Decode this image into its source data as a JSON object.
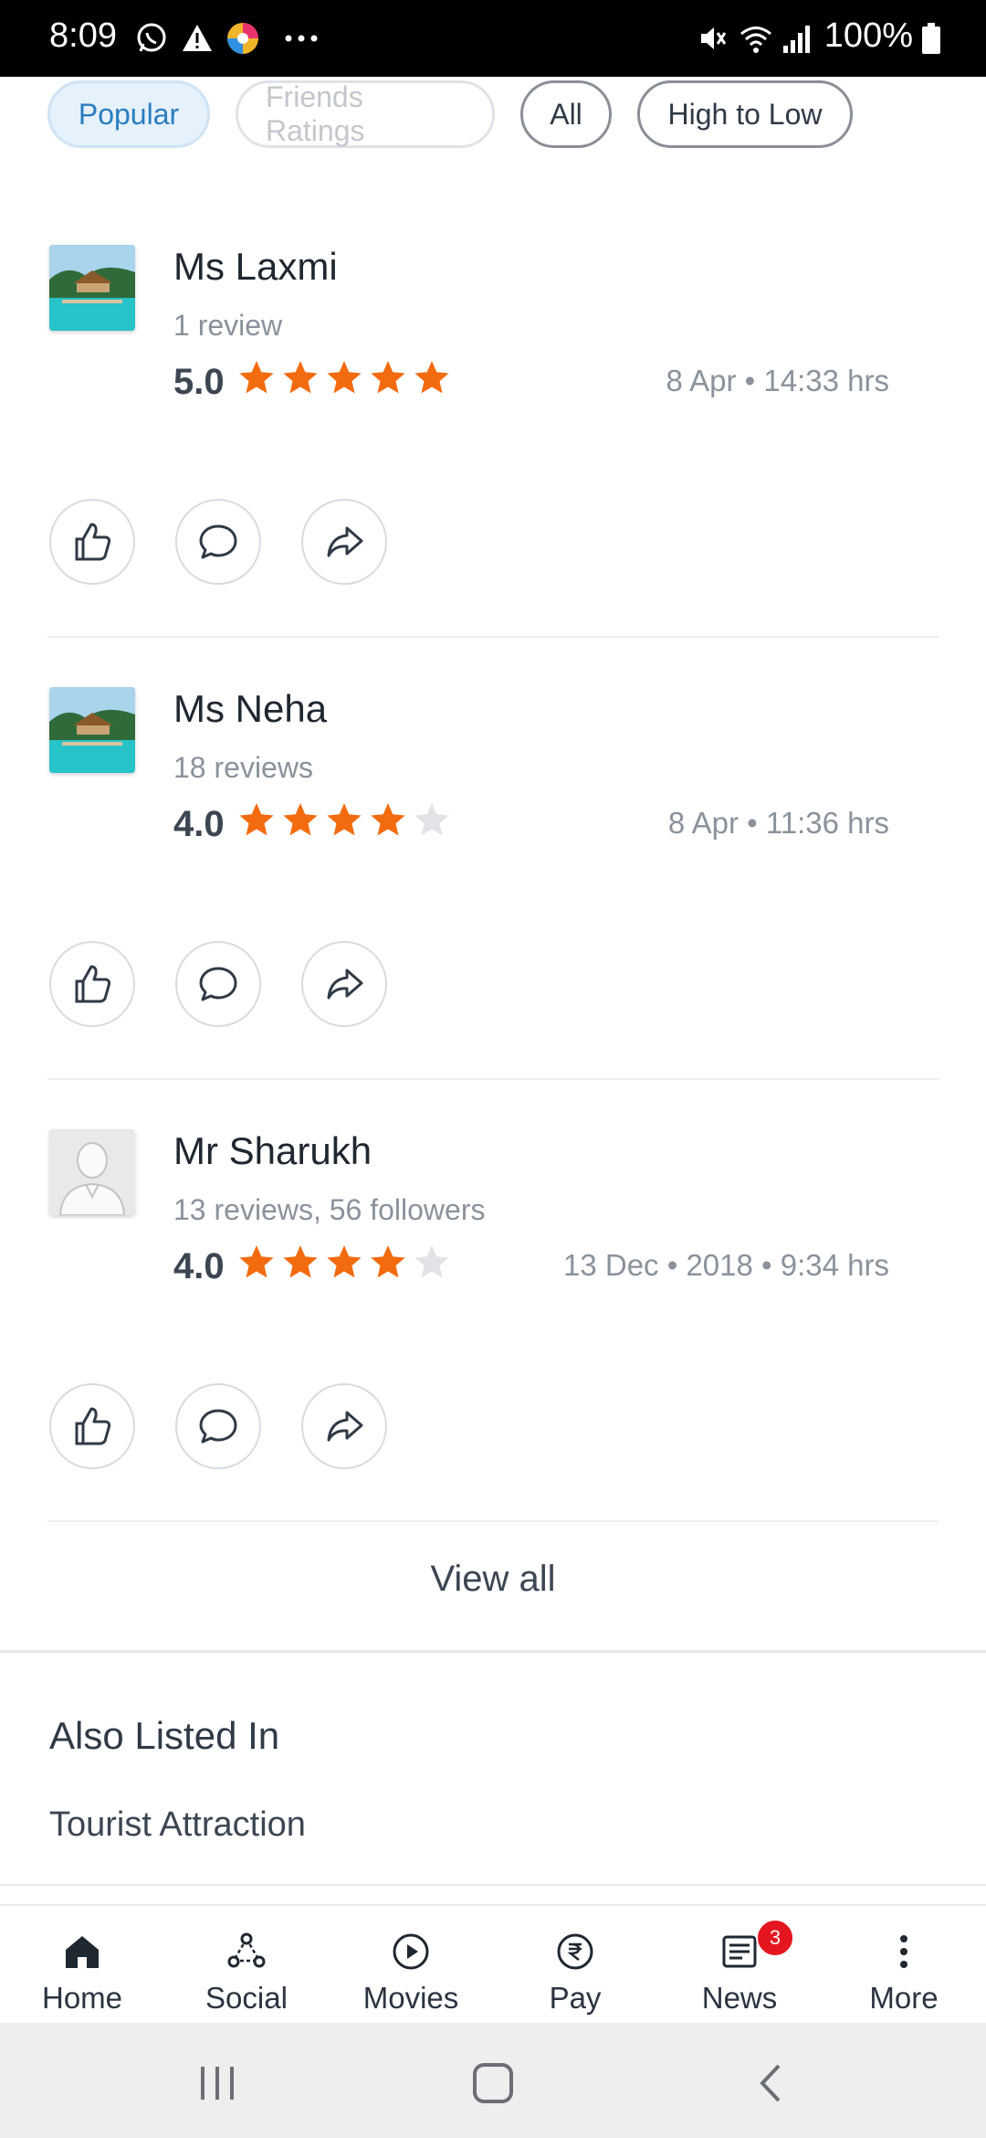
{
  "status_bar": {
    "time": "8:09",
    "battery": "100%",
    "icons": [
      "whatsapp-icon",
      "warning-icon",
      "colorful-app-icon",
      "more-dots-icon",
      "mute-icon",
      "wifi-icon",
      "signal-icon",
      "battery-icon"
    ]
  },
  "filters": {
    "popular": "Popular",
    "friends": "Friends Ratings",
    "all": "All",
    "sort": "High to Low"
  },
  "reviews": [
    {
      "name": "Ms Laxmi",
      "sub": "1 review",
      "score": "5.0",
      "stars": 5,
      "date": "8 Apr • 14:33 hrs",
      "avatar": "resort-photo"
    },
    {
      "name": "Ms Neha",
      "sub": "18 reviews",
      "score": "4.0",
      "stars": 4,
      "date": "8 Apr • 11:36 hrs",
      "avatar": "resort-photo"
    },
    {
      "name": "Mr Sharukh",
      "sub": "13 reviews, 56 followers",
      "score": "4.0",
      "stars": 4,
      "date": "13 Dec • 2018 • 9:34 hrs",
      "avatar": "default-user"
    }
  ],
  "view_all": "View all",
  "also_listed": {
    "title": "Also Listed In",
    "item": "Tourist Attraction"
  },
  "bottom_nav": [
    {
      "label": "Home",
      "icon": "home-icon"
    },
    {
      "label": "Social",
      "icon": "social-icon"
    },
    {
      "label": "Movies",
      "icon": "play-icon"
    },
    {
      "label": "Pay",
      "icon": "rupee-icon"
    },
    {
      "label": "News",
      "icon": "news-icon",
      "badge": "3"
    },
    {
      "label": "More",
      "icon": "more-vertical-icon"
    }
  ],
  "colors": {
    "star_on": "#f26b0f",
    "star_off": "#e1e3e6",
    "active_chip_bg": "#e5f1fb",
    "active_chip_text": "#2a7dbf",
    "badge": "#e5161f"
  }
}
